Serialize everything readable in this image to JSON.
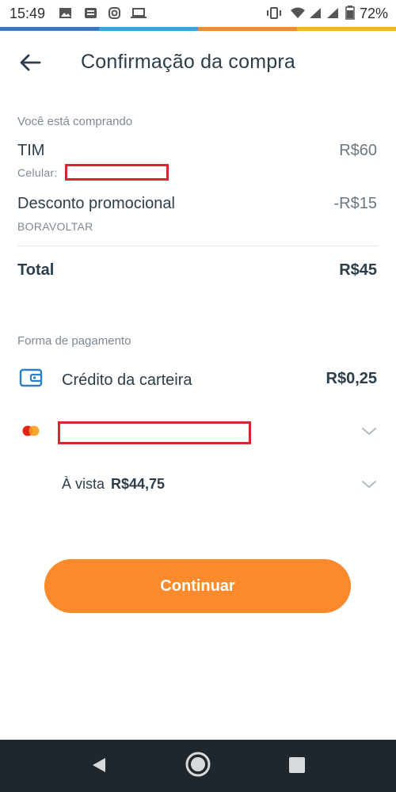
{
  "status_bar": {
    "time": "15:49",
    "battery_percent": "72%",
    "icons": [
      "image-icon",
      "news-icon",
      "instagram-icon",
      "laptop-icon",
      "vibrate-icon",
      "wifi-icon",
      "signal-icon",
      "signal-icon",
      "battery-icon"
    ]
  },
  "header": {
    "title": "Confirmação da compra"
  },
  "purchase": {
    "section_label": "Você está comprando",
    "product_name": "TIM",
    "product_price": "R$60",
    "phone_label": "Celular:",
    "discount_label": "Desconto promocional",
    "discount_code": "BORAVOLTAR",
    "discount_value": "-R$15",
    "total_label": "Total",
    "total_value": "R$45"
  },
  "payment": {
    "section_label": "Forma de pagamento",
    "wallet_label": "Crédito da carteira",
    "wallet_value": "R$0,25",
    "installment_prefix": "À vista",
    "installment_value": "R$44,75"
  },
  "actions": {
    "continue_label": "Continuar"
  },
  "colors": {
    "accent": "#fa8a2b",
    "redaction": "#d7262f",
    "nav_bg": "#1f272d"
  }
}
